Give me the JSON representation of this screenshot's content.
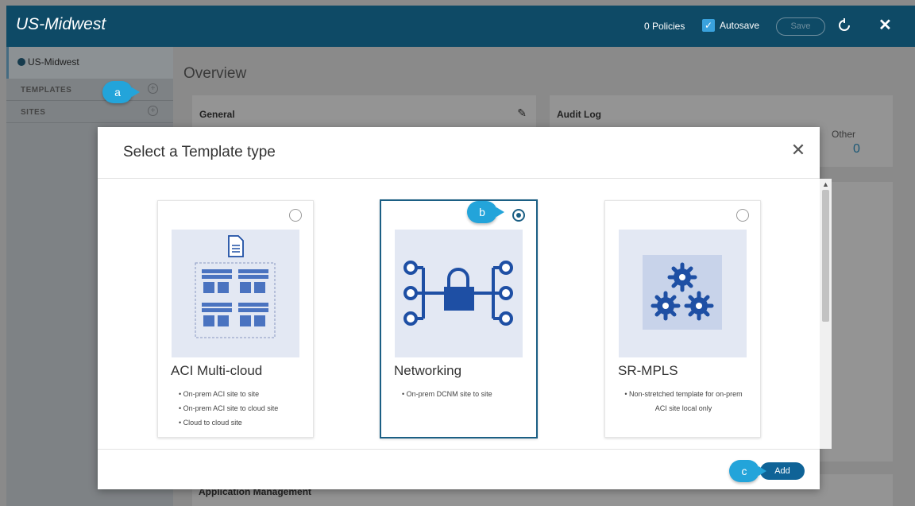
{
  "topbar": {
    "title": "US-Midwest",
    "policies": "0 Policies",
    "autosave_label": "Autosave",
    "save_label": "Save"
  },
  "sidebar": {
    "schema_name": "US-Midwest",
    "templates_label": "TEMPLATES",
    "sites_label": "SITES"
  },
  "main": {
    "overview_title": "Overview",
    "general_title": "General",
    "audit_title": "Audit Log",
    "other_label": "Other",
    "other_value": "0",
    "app_mgmt_title": "Application Management"
  },
  "callouts": {
    "a": "a",
    "b": "b",
    "c": "c"
  },
  "modal": {
    "title": "Select a Template type",
    "add_label": "Add",
    "cards": [
      {
        "name": "ACI Multi-cloud",
        "selected": false,
        "bullets": [
          "On-prem ACI site to site",
          "On-prem ACI site to cloud site",
          "Cloud to cloud site"
        ]
      },
      {
        "name": "Networking",
        "selected": true,
        "bullets": [
          "On-prem DCNM site to site"
        ]
      },
      {
        "name": "SR-MPLS",
        "selected": false,
        "bullets": [
          "Non-stretched template for on-prem ACI site local only"
        ]
      }
    ]
  },
  "colors": {
    "header": "#0e4a66",
    "accent": "#1b5f84",
    "callout": "#23a4da",
    "illus_bg": "#e3e8f3",
    "icon_blue": "#1e4fa4"
  }
}
